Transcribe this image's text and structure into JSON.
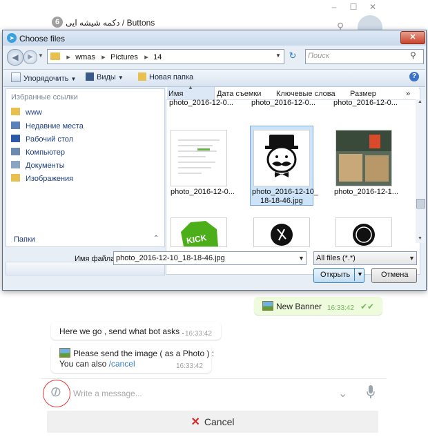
{
  "telegram": {
    "badge_count": "6",
    "chat_title": "دکمه شیشه ایی / Buttons",
    "messages": {
      "out1": {
        "text": "New Banner",
        "time": "16:33:42"
      },
      "in1": {
        "text": "Here we go , send what bot asks .",
        "time": "16:33:42"
      },
      "in2": {
        "line1": "Please send the image ( as a Photo ) :",
        "line2_prefix": "You can also ",
        "link": "/cancel",
        "time": "16:33:42"
      }
    },
    "compose_placeholder": "Write a message...",
    "cancel_button": "Cancel"
  },
  "dialog": {
    "title": "Choose files",
    "breadcrumb": [
      "wmas",
      "Pictures",
      "14"
    ],
    "search_placeholder": "Поиск",
    "toolbar": {
      "organize": "Упорядочить",
      "views": "Виды",
      "new_folder": "Новая папка"
    },
    "favorites_header": "Избранные ссылки",
    "nav_items": [
      {
        "label": "www"
      },
      {
        "label": "Недавние места"
      },
      {
        "label": "Рабочий стол"
      },
      {
        "label": "Компьютер"
      },
      {
        "label": "Документы"
      },
      {
        "label": "Изображения"
      }
    ],
    "folders_label": "Папки",
    "columns": [
      "Имя",
      "Дата съемки",
      "Ключевые слова",
      "Размер"
    ],
    "files_top": [
      "photo_2016-12-0...",
      "photo_2016-12-0...",
      "photo_2016-12-0..."
    ],
    "files_mid": [
      "photo_2016-12-0...",
      "photo_2016-12-10_18-18-46.jpg",
      "photo_2016-12-1..."
    ],
    "selected_name_line1": "photo_2016-12-10_",
    "selected_name_line2": "18-18-46.jpg",
    "kick_text": "KICK",
    "filename_label": "Имя файла:",
    "filename_value": "photo_2016-12-10_18-18-46.jpg",
    "filetype_value": "All files (*.*)",
    "open_button": "Открыть",
    "cancel_button": "Отмена"
  },
  "colors": {
    "accent": "#3a7ec6",
    "highlight": "#e03a3a",
    "out_bubble": "#eefbdc"
  }
}
